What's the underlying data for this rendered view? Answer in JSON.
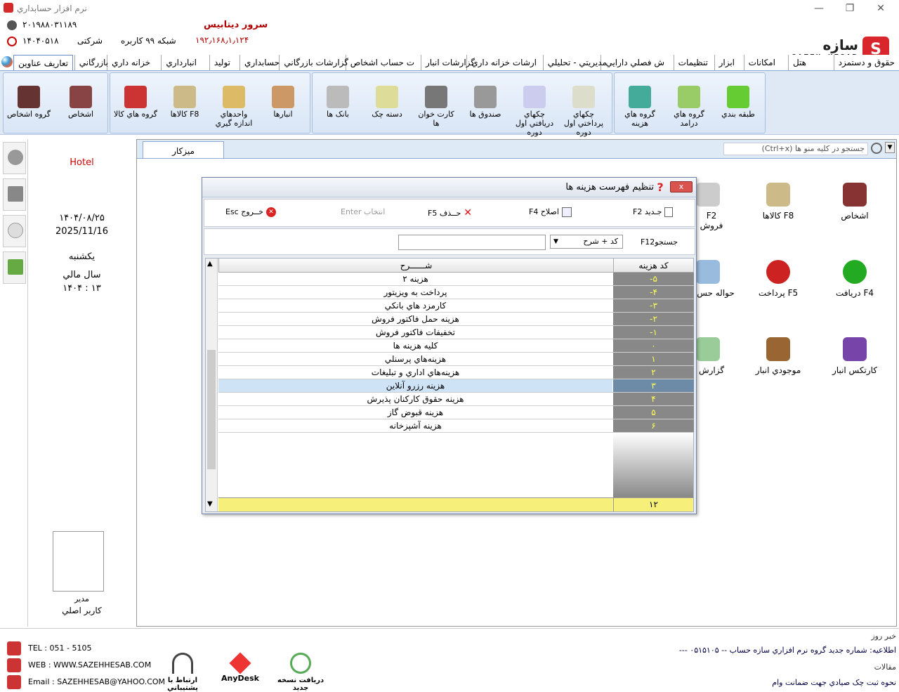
{
  "window": {
    "title": "نرم افزار حسابداري"
  },
  "header": {
    "phone_id": "۲۰۱۹۸۸۰۳۱۱۸۹",
    "license": "۱۴۰۴۰۵۱۸",
    "license_type": "شرکتی",
    "server_label": "سرور ديتابيس",
    "network": "شبکه ۹۹ کاربره",
    "ip": "۱۹۲٫۱۶۸٫۱٫۱۲۴",
    "logo_fa": "سازه حساب",
    "logo_en": "SAZEH HESAB"
  },
  "tabs": [
    "حقوق و دستمزد",
    "هتل",
    "امکانات",
    "ابزار",
    "تنظيمات",
    "ش فصلي دارايي",
    "مديريتي - تحليلي",
    "ارشات خزانه داري",
    "گزارشات انبار",
    "ت حساب اشخاص",
    "گزارشات بازرگاني",
    "حسابداري",
    "توليد",
    "انبارداري",
    "خزانه داري",
    "بازرگاني",
    "تعاريف عناوين"
  ],
  "ribbon": {
    "groups": [
      {
        "items": [
          "طبقه بندي",
          "گروه هاي درامد",
          "گروه هاي هزينه"
        ]
      },
      {
        "items": [
          "چکهاي پرداختي اول دوره",
          "چکهاي دريافتي اول دوره",
          "صندوق ها",
          "کارت خوان ها",
          "دسته چک",
          "بانک ها"
        ]
      },
      {
        "items": [
          "انبارها",
          "واحدهاي اندازه گيري",
          "F8 کالاها",
          "گروه هاي کالا"
        ]
      },
      {
        "items": [
          "اشخاص",
          "گروه اشخاص"
        ]
      }
    ]
  },
  "side_panel": {
    "hotel": "Hotel",
    "date_fa": "۱۴۰۴/۰۸/۲۵",
    "date_en": "2025/11/16",
    "weekday": "يکشنبه",
    "fiscal_label": "سال مالي",
    "fiscal": "۱۴۰۴ : ۱۳",
    "user_role": "مدير",
    "user_name": "کاربر اصلي"
  },
  "workspace": {
    "tab": "ميزکار",
    "search_placeholder": "جستجو در کليه منو ها  (Ctrl+x)",
    "icons": [
      {
        "label": "اشخاص",
        "key": ""
      },
      {
        "label": "کالاها",
        "key": "F8"
      },
      {
        "label": "فروش",
        "key": "F2"
      },
      {
        "label": "دريافت",
        "key": "F4"
      },
      {
        "label": "پرداخت",
        "key": "F5"
      },
      {
        "label": "حواله حس",
        "key": ""
      },
      {
        "label": "کارتکس انبار",
        "key": ""
      },
      {
        "label": "موجودي انبار",
        "key": ""
      },
      {
        "label": "گزارش",
        "key": ""
      }
    ]
  },
  "dialog": {
    "title": "تنظيم فهرست هزينه ها",
    "close": "x",
    "toolbar": {
      "new": "جـديد F2",
      "edit": "اصلاح F4",
      "delete": "حــذف F5",
      "select": "انتخاب Enter",
      "exit": "خــروج Esc"
    },
    "filter": {
      "search_label": "F12جستجو",
      "mode": "کد + شرح",
      "query": ""
    },
    "columns": {
      "code": "کد هزينه",
      "desc": "شــــــرح"
    },
    "rows": [
      {
        "code": "-۵",
        "desc": "هزينه ۲"
      },
      {
        "code": "-۴",
        "desc": "پرداخت به ويزيتور"
      },
      {
        "code": "-۳",
        "desc": "کارمزد هاي بانکي"
      },
      {
        "code": "-۲",
        "desc": "هزينه حمل فاکتور فروش"
      },
      {
        "code": "-۱",
        "desc": "تخفيفات فاکتور فروش"
      },
      {
        "code": "۰",
        "desc": "کليه هزينه ها"
      },
      {
        "code": "۱",
        "desc": "هزينه‌هاي پرسنلي"
      },
      {
        "code": "۲",
        "desc": "هزينه‌هاي اداري و تبليغات"
      },
      {
        "code": "۳",
        "desc": "هزينه رزرو آنلاين"
      },
      {
        "code": "۴",
        "desc": "هزينه حقوق کارکنان پذيرش"
      },
      {
        "code": "۵",
        "desc": "هزينه قبوض گاز"
      },
      {
        "code": "۶",
        "desc": "هزينه آشپزخانه"
      }
    ],
    "selected_index": 8,
    "total": "۱۲"
  },
  "bottom": {
    "tel": "TEL : 051 - 5105",
    "web": "WEB : WWW.SAZEHHESAB.COM",
    "email": "Email : SAZEHHESAB@YAHOO.COM",
    "support": "ارتباط با پشتيباني",
    "anydesk": "AnyDesk",
    "update": "دريافت نسخه جديد",
    "news_title": "خبر روز",
    "news": "اطلاعيه: شماره جديد گروه نرم افزاري سازه حساب -- ۰۵۱۵۱۰۵ ---",
    "articles_title": "مقالات",
    "article": "نحوه ثبت چک صيادي جهت ضمانت وام"
  },
  "colors": {
    "accent": "#d8262c",
    "ribbon": "#dfe9f6",
    "grid_code": "#888888",
    "selected_row": "#cfe3f6",
    "total_row": "#f6f07a"
  }
}
